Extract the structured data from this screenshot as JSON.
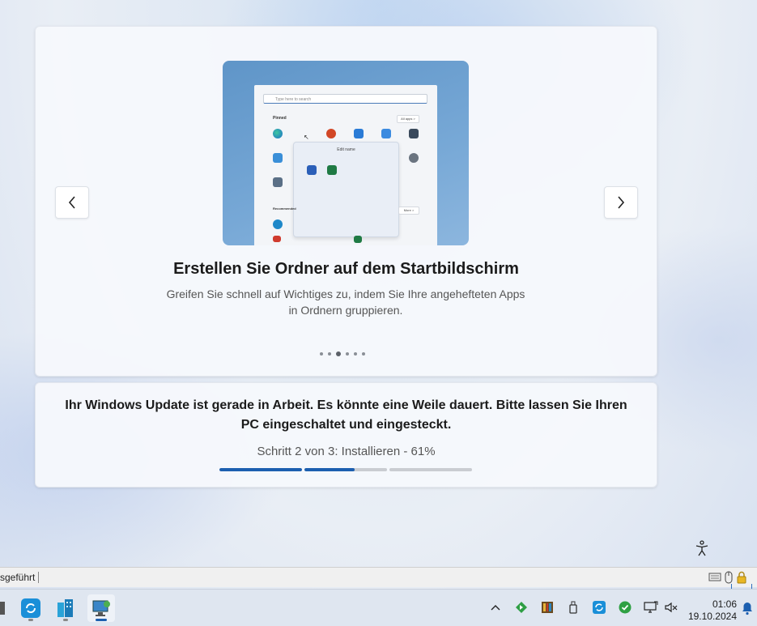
{
  "slide": {
    "title": "Erstellen Sie Ordner auf dem Startbildschirm",
    "description": "Greifen Sie schnell auf Wichtiges zu, indem Sie Ihre angehefteten Apps in Ordnern gruppieren.",
    "dots_total": 6,
    "dots_active_index": 2
  },
  "hero": {
    "search_placeholder": "Type here to search",
    "pinned_label": "Pinned",
    "all_apps_label": "All apps >",
    "folder_title": "Edit name",
    "recommended_label": "Recommended",
    "more_label": "More >"
  },
  "status": {
    "message": "Ihr Windows Update ist gerade in Arbeit. Es könnte eine Weile dauert. Bitte lassen Sie Ihren PC eingeschaltet und eingesteckt.",
    "step_text": "Schritt 2 von 3: Installieren - 61%",
    "step_current": 2,
    "step_total": 3,
    "current_progress": 0.61,
    "accent_color": "#1c5fb0"
  },
  "statusbar": {
    "left_text": "sgeführt"
  },
  "taskbar": {
    "time": "01:06",
    "date": "19.10.2024"
  }
}
